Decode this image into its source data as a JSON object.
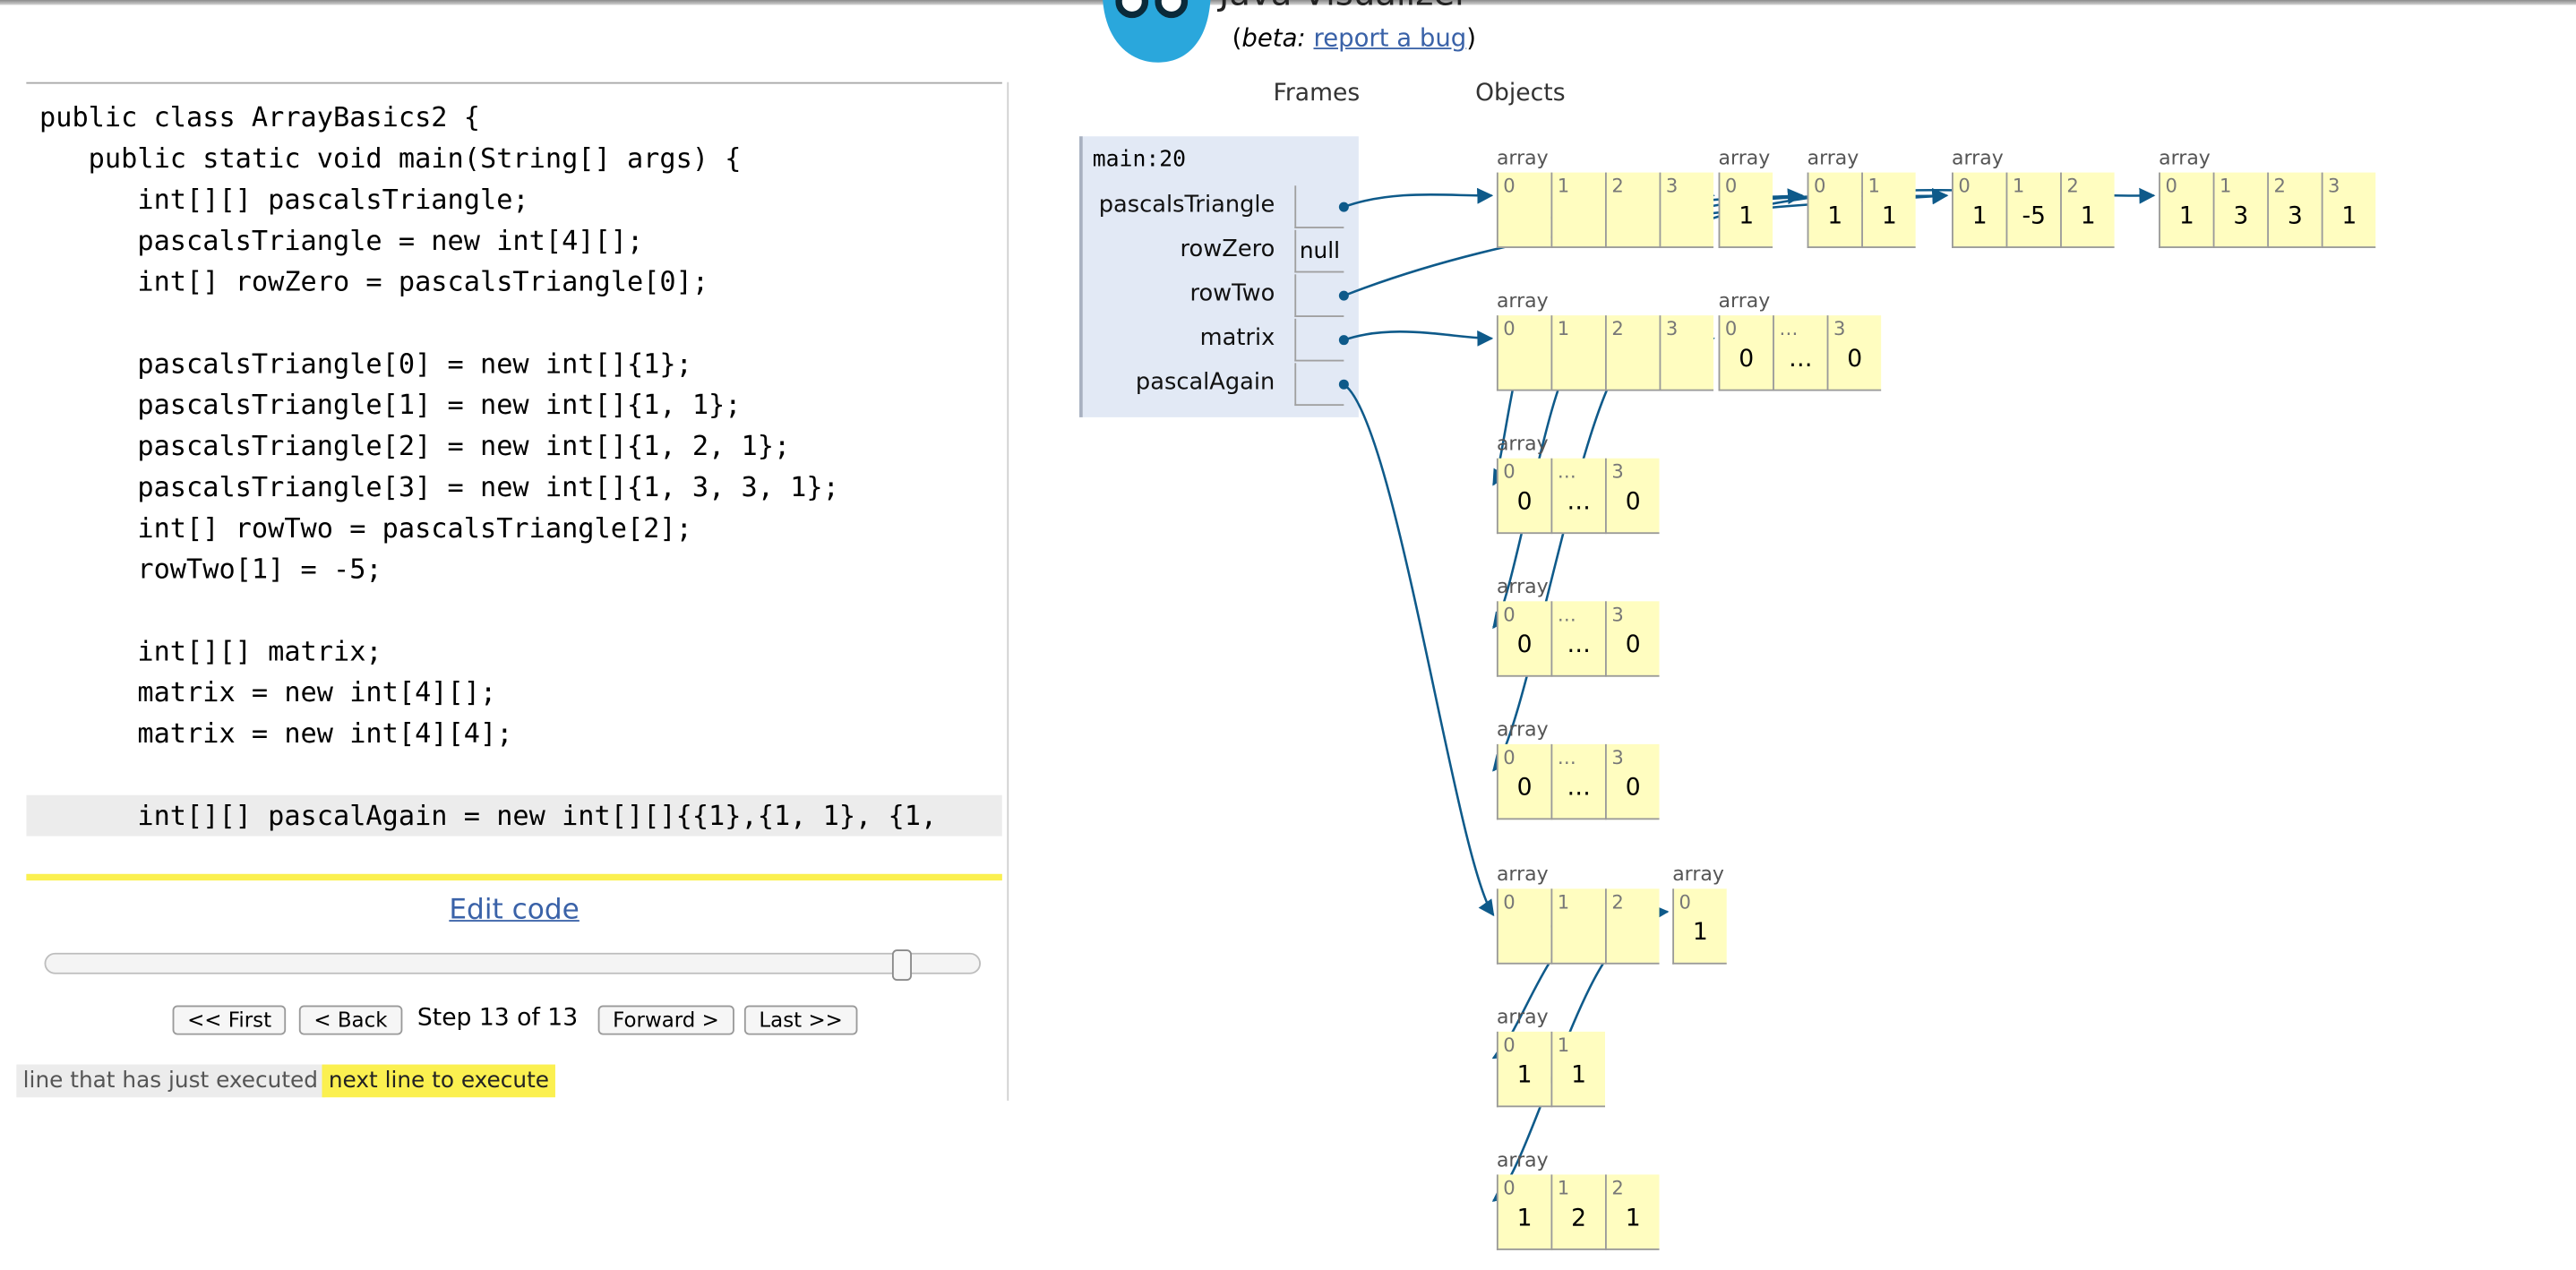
{
  "header": {
    "title": "Java Visualizer",
    "beta_label": "beta:",
    "report_link": "report a bug"
  },
  "code": {
    "lines": [
      "public class ArrayBasics2 {",
      "   public static void main(String[] args) {",
      "      int[][] pascalsTriangle;",
      "      pascalsTriangle = new int[4][];",
      "      int[] rowZero = pascalsTriangle[0];",
      "",
      "      pascalsTriangle[0] = new int[]{1};",
      "      pascalsTriangle[1] = new int[]{1, 1};",
      "      pascalsTriangle[2] = new int[]{1, 2, 1};",
      "      pascalsTriangle[3] = new int[]{1, 3, 3, 1};",
      "      int[] rowTwo = pascalsTriangle[2];",
      "      rowTwo[1] = -5;",
      "",
      "      int[][] matrix;",
      "      matrix = new int[4][];",
      "      matrix = new int[4][4];",
      "",
      "      int[][] pascalAgain = new int[][]{{1},{1, 1}, {1,"
    ],
    "just_executed_line": 18
  },
  "controls": {
    "edit_code": "Edit code",
    "first": "<< First",
    "back": "< Back",
    "step_text": "Step 13 of 13",
    "forward": "Forward >",
    "last": "Last >>",
    "step_current": 13,
    "step_total": 13
  },
  "legend": {
    "just_executed": "line that has just executed",
    "next_line": "next line to execute"
  },
  "visualizer": {
    "frames_heading": "Frames",
    "objects_heading": "Objects",
    "frame_name": "main:20",
    "variables": [
      {
        "name": "pascalsTriangle",
        "value": "",
        "is_pointer": true
      },
      {
        "name": "rowZero",
        "value": "null",
        "is_pointer": false
      },
      {
        "name": "rowTwo",
        "value": "",
        "is_pointer": true
      },
      {
        "name": "matrix",
        "value": "",
        "is_pointer": true
      },
      {
        "name": "pascalAgain",
        "value": "",
        "is_pointer": true
      }
    ],
    "array_label": "array",
    "arrays": [
      {
        "id": "pt",
        "indices": [
          "0",
          "1",
          "2",
          "3"
        ],
        "values": [
          "",
          "",
          "",
          ""
        ]
      },
      {
        "id": "pt0",
        "indices": [
          "0"
        ],
        "values": [
          "1"
        ]
      },
      {
        "id": "pt1",
        "indices": [
          "0",
          "1"
        ],
        "values": [
          "1",
          "1"
        ]
      },
      {
        "id": "pt2",
        "indices": [
          "0",
          "1",
          "2"
        ],
        "values": [
          "1",
          "-5",
          "1"
        ]
      },
      {
        "id": "pt3",
        "indices": [
          "0",
          "1",
          "2",
          "3"
        ],
        "values": [
          "1",
          "3",
          "3",
          "1"
        ]
      },
      {
        "id": "mx",
        "indices": [
          "0",
          "1",
          "2",
          "3"
        ],
        "values": [
          "",
          "",
          "",
          ""
        ]
      },
      {
        "id": "mx0",
        "indices": [
          "0",
          "…",
          "3"
        ],
        "values": [
          "0",
          "…",
          "0"
        ]
      },
      {
        "id": "mx1",
        "indices": [
          "0",
          "…",
          "3"
        ],
        "values": [
          "0",
          "…",
          "0"
        ]
      },
      {
        "id": "mx2",
        "indices": [
          "0",
          "…",
          "3"
        ],
        "values": [
          "0",
          "…",
          "0"
        ]
      },
      {
        "id": "mx3",
        "indices": [
          "0",
          "…",
          "3"
        ],
        "values": [
          "0",
          "…",
          "0"
        ]
      },
      {
        "id": "pa",
        "indices": [
          "0",
          "1",
          "2"
        ],
        "values": [
          "",
          "",
          ""
        ]
      },
      {
        "id": "pa0",
        "indices": [
          "0"
        ],
        "values": [
          "1"
        ]
      },
      {
        "id": "pa1",
        "indices": [
          "0",
          "1"
        ],
        "values": [
          "1",
          "1"
        ]
      },
      {
        "id": "pa2",
        "indices": [
          "0",
          "1",
          "2"
        ],
        "values": [
          "1",
          "2",
          "1"
        ]
      }
    ],
    "arrow_color": "#0e5a8a"
  }
}
